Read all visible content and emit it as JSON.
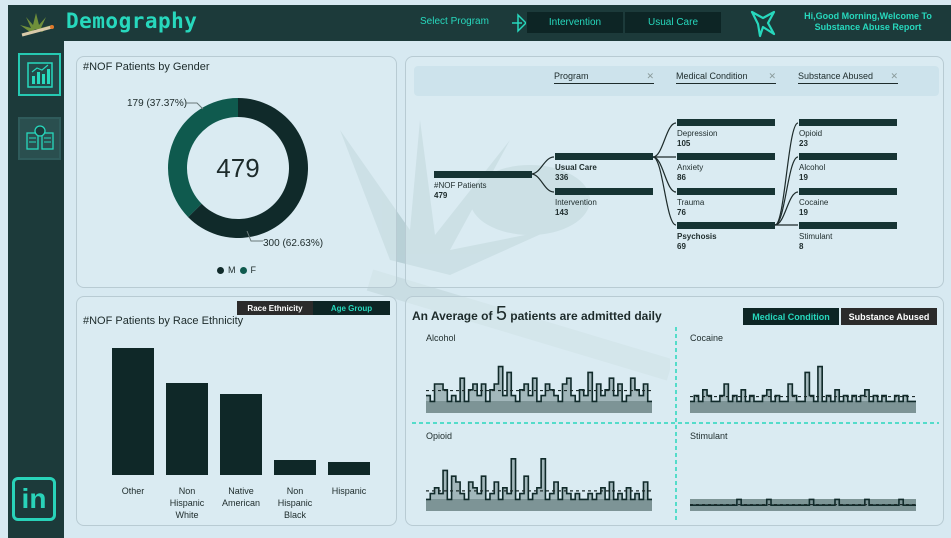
{
  "header": {
    "title": "Demography",
    "select_label": "Select Program",
    "programs": [
      "Intervention",
      "Usual Care"
    ],
    "greeting": "Hi,Good Morning,Welcome To Substance Abuse Report"
  },
  "sidebar": {
    "items": [
      {
        "icon": "chart-report-icon",
        "active": true
      },
      {
        "icon": "versus-compare-icon",
        "active": false
      }
    ],
    "linkedin_label": "in"
  },
  "gender": {
    "title": "#NOF Patients by Gender",
    "total": "479",
    "female_label": "179 (37.37%)",
    "male_label": "300 (62.63%)",
    "legend": [
      {
        "label": "M",
        "color": "#102a2a"
      },
      {
        "label": "F",
        "color": "#0f5a4e"
      }
    ],
    "chart_data": {
      "type": "pie",
      "categories": [
        "M",
        "F"
      ],
      "values": [
        300,
        179
      ]
    }
  },
  "decomp": {
    "headers": [
      "Program",
      "Medical Condition",
      "Substance Abused"
    ],
    "root": {
      "label": "#NOF Patients",
      "value": "479"
    },
    "program": [
      {
        "label": "Usual Care",
        "value": "336",
        "bold": true
      },
      {
        "label": "Intervention",
        "value": "143",
        "bold": false
      }
    ],
    "condition": [
      {
        "label": "Depression",
        "value": "105"
      },
      {
        "label": "Anxiety",
        "value": "86"
      },
      {
        "label": "Trauma",
        "value": "76"
      },
      {
        "label": "Psychosis",
        "value": "69",
        "bold": true
      }
    ],
    "substance": [
      {
        "label": "Opioid",
        "value": "23"
      },
      {
        "label": "Alcohol",
        "value": "19"
      },
      {
        "label": "Cocaine",
        "value": "19"
      },
      {
        "label": "Stimulant",
        "value": "8"
      }
    ]
  },
  "race": {
    "title": "#NOF Patients by Race Ethnicity",
    "toggles": [
      "Race Ethnicity",
      "Age Group"
    ],
    "chart_data": {
      "type": "bar",
      "categories": [
        "Other",
        "Non Hispanic White",
        "Native American",
        "Non Hispanic Black",
        "Hispanic"
      ],
      "values": [
        128,
        93,
        82,
        15,
        13
      ]
    },
    "labels": [
      [
        "Other"
      ],
      [
        "Non",
        "Hispanic",
        "White"
      ],
      [
        "Native",
        "American"
      ],
      [
        "Non",
        "Hispanic",
        "Black"
      ],
      [
        "Hispanic"
      ]
    ]
  },
  "avg": {
    "prefix": "An Average of",
    "number": "5",
    "suffix": "patients are admitted daily",
    "buttons": [
      "Medical Condition",
      "Substance Abused"
    ],
    "minis": [
      "Alcohol",
      "Cocaine",
      "Opioid",
      "Stimulant"
    ],
    "chart_data": [
      {
        "type": "line",
        "name": "Alcohol",
        "values": [
          3,
          2,
          5,
          5,
          4,
          2,
          3,
          2,
          6,
          2,
          4,
          5,
          3,
          5,
          2,
          4,
          5,
          8,
          3,
          7,
          3,
          2,
          4,
          5,
          3,
          6,
          2,
          3,
          5,
          4,
          3,
          2,
          5,
          6,
          3,
          2,
          4,
          3,
          7,
          2,
          5,
          3,
          4,
          6,
          3,
          5,
          2,
          3,
          6,
          4,
          3,
          5,
          2
        ]
      },
      {
        "type": "line",
        "name": "Cocaine",
        "values": [
          2,
          3,
          2,
          4,
          3,
          2,
          2,
          3,
          5,
          2,
          3,
          2,
          4,
          2,
          3,
          2,
          2,
          3,
          4,
          2,
          3,
          2,
          2,
          5,
          3,
          2,
          2,
          7,
          3,
          2,
          8,
          2,
          3,
          2,
          4,
          2,
          3,
          2,
          3,
          2,
          3,
          4,
          2,
          3,
          2,
          3,
          2,
          2,
          3,
          2,
          3,
          2,
          2
        ]
      },
      {
        "type": "line",
        "name": "Opioid",
        "values": [
          2,
          3,
          4,
          3,
          7,
          2,
          6,
          5,
          3,
          2,
          5,
          4,
          3,
          6,
          2,
          3,
          5,
          2,
          4,
          3,
          9,
          2,
          3,
          6,
          2,
          3,
          4,
          9,
          2,
          3,
          5,
          2,
          4,
          3,
          2,
          3,
          2,
          2,
          3,
          2,
          3,
          4,
          2,
          5,
          2,
          3,
          2,
          4,
          2,
          3,
          2,
          5,
          2
        ]
      },
      {
        "type": "line",
        "name": "Stimulant",
        "values": [
          1,
          1,
          1,
          1,
          1,
          1,
          1,
          1,
          1,
          1,
          1,
          2,
          1,
          1,
          1,
          1,
          1,
          1,
          2,
          1,
          1,
          1,
          1,
          1,
          1,
          1,
          1,
          1,
          2,
          1,
          1,
          1,
          1,
          1,
          2,
          1,
          1,
          1,
          1,
          1,
          1,
          2,
          1,
          1,
          1,
          1,
          1,
          1,
          1,
          2,
          1,
          1,
          1
        ]
      }
    ]
  }
}
